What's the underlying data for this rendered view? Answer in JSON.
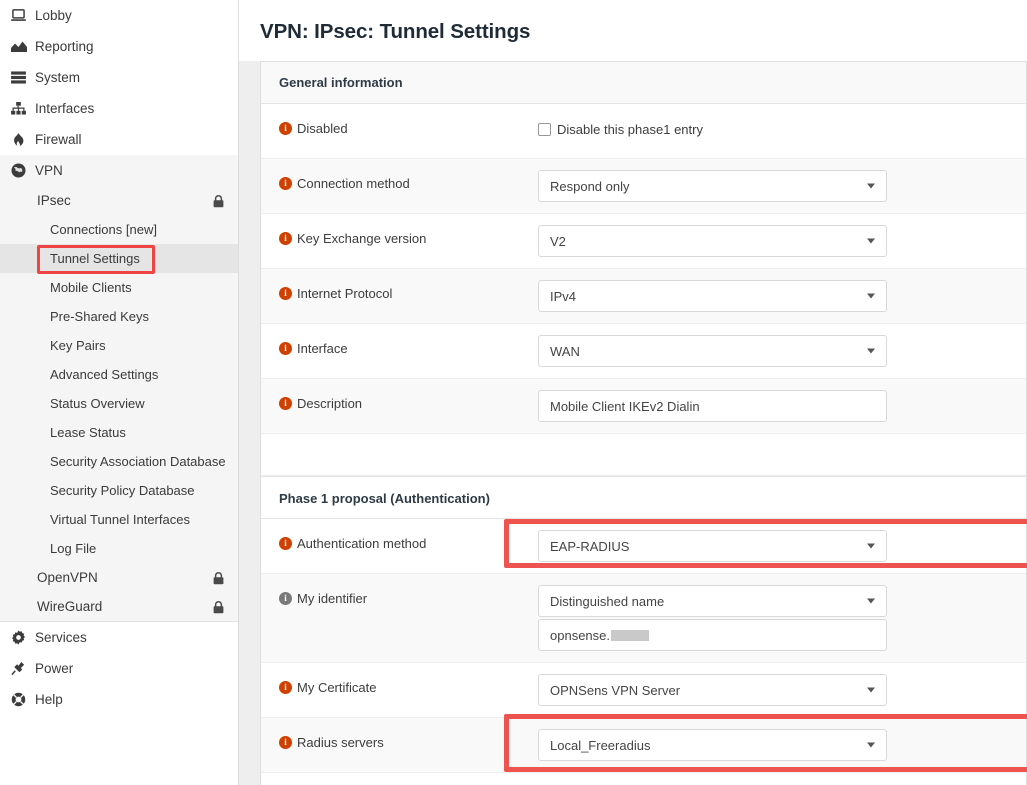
{
  "page": {
    "title": "VPN: IPsec: Tunnel Settings"
  },
  "colors": {
    "highlight": "#ef5350",
    "info_icon": "#d04000",
    "info_icon_muted": "#7a7a7a",
    "active_nav_bg": "#e5e5e5",
    "group_bg": "#f5f5f5"
  },
  "sidebar": {
    "items": [
      {
        "label": "Lobby",
        "icon": "laptop-icon"
      },
      {
        "label": "Reporting",
        "icon": "area-chart-icon"
      },
      {
        "label": "System",
        "icon": "server-stack-icon"
      },
      {
        "label": "Interfaces",
        "icon": "sitemap-icon"
      },
      {
        "label": "Firewall",
        "icon": "fire-icon"
      },
      {
        "label": "VPN",
        "icon": "globe-icon"
      }
    ],
    "vpn_children": [
      {
        "label": "IPsec",
        "locked": true
      },
      {
        "label": "OpenVPN",
        "locked": true
      },
      {
        "label": "WireGuard",
        "locked": true
      }
    ],
    "ipsec_children": [
      {
        "label": "Connections [new]",
        "active": false
      },
      {
        "label": "Tunnel Settings",
        "active": true
      },
      {
        "label": "Mobile Clients",
        "active": false
      },
      {
        "label": "Pre-Shared Keys",
        "active": false
      },
      {
        "label": "Key Pairs",
        "active": false
      },
      {
        "label": "Advanced Settings",
        "active": false
      },
      {
        "label": "Status Overview",
        "active": false
      },
      {
        "label": "Lease Status",
        "active": false
      },
      {
        "label": "Security Association Database",
        "active": false
      },
      {
        "label": "Security Policy Database",
        "active": false
      },
      {
        "label": "Virtual Tunnel Interfaces",
        "active": false
      },
      {
        "label": "Log File",
        "active": false
      }
    ],
    "bottom_items": [
      {
        "label": "Services",
        "icon": "gear-icon"
      },
      {
        "label": "Power",
        "icon": "power-plug-icon"
      },
      {
        "label": "Help",
        "icon": "lifebuoy-icon"
      }
    ]
  },
  "form": {
    "general_section": "General information",
    "phase1_section": "Phase 1 proposal (Authentication)",
    "disabled": {
      "label": "Disabled",
      "checkbox_label": "Disable this phase1 entry",
      "checked": false
    },
    "connection_method": {
      "label": "Connection method",
      "value": "Respond only"
    },
    "key_exchange_version": {
      "label": "Key Exchange version",
      "value": "V2"
    },
    "internet_protocol": {
      "label": "Internet Protocol",
      "value": "IPv4"
    },
    "interface": {
      "label": "Interface",
      "value": "WAN"
    },
    "description": {
      "label": "Description",
      "value": "Mobile Client IKEv2 Dialin"
    },
    "authentication_method": {
      "label": "Authentication method",
      "value": "EAP-RADIUS",
      "highlighted": true
    },
    "my_identifier": {
      "label": "My identifier",
      "type_value": "Distinguished name",
      "value_prefix": "opnsense.",
      "value_redacted": true
    },
    "my_certificate": {
      "label": "My Certificate",
      "value": "OPNSens VPN Server"
    },
    "radius_servers": {
      "label": "Radius servers",
      "value": "Local_Freeradius",
      "highlighted": true
    }
  }
}
